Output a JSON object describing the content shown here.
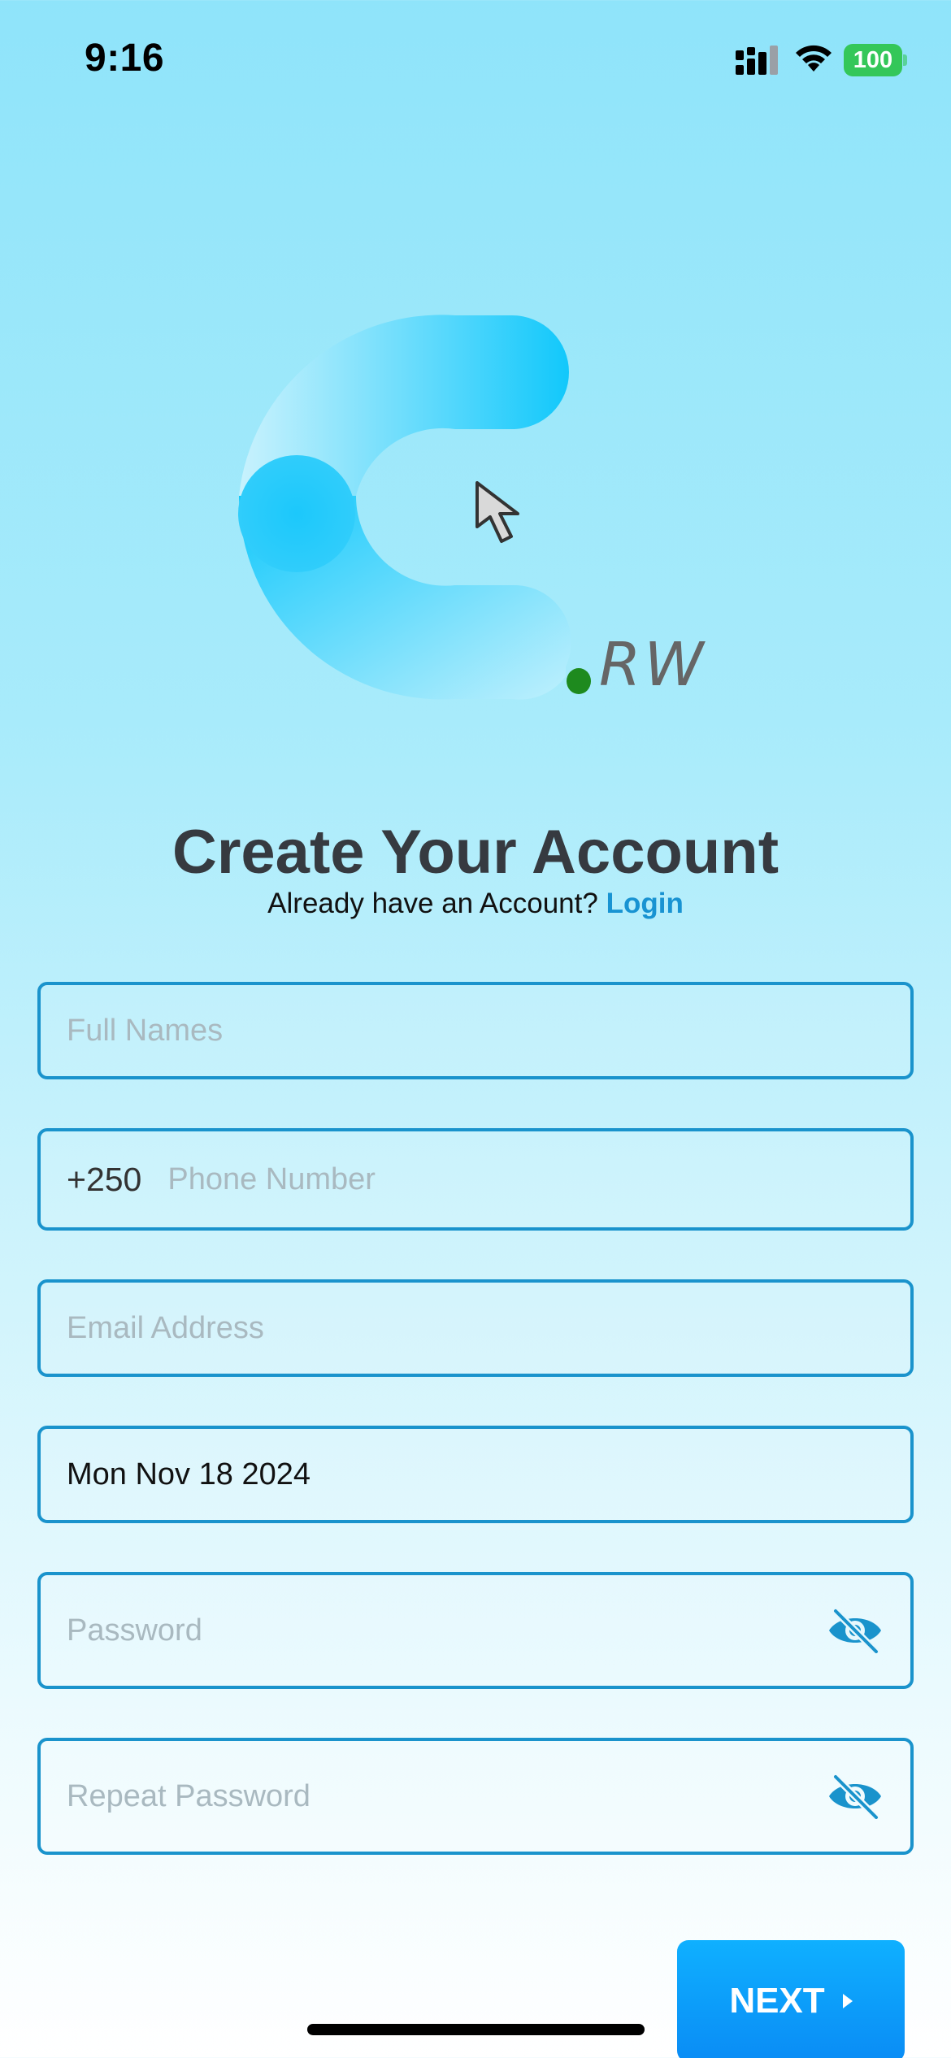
{
  "status_bar": {
    "time": "9:16",
    "battery": "100"
  },
  "logo": {
    "suffix": "RW",
    "icon": "c-logo-icon"
  },
  "header": {
    "title": "Create Your Account",
    "prompt": "Already have an Account?",
    "login_link": "Login"
  },
  "form": {
    "full_names": {
      "placeholder": "Full Names",
      "value": ""
    },
    "phone": {
      "prefix": "+250",
      "placeholder": "Phone Number",
      "value": ""
    },
    "email": {
      "placeholder": "Email Address",
      "value": ""
    },
    "date": {
      "value": "Mon Nov 18 2024"
    },
    "password": {
      "placeholder": "Password",
      "value": ""
    },
    "repeat_password": {
      "placeholder": "Repeat Password",
      "value": ""
    }
  },
  "actions": {
    "next_label": "NEXT"
  },
  "colors": {
    "accent": "#1893d2",
    "button": "#0a8cf5",
    "border": "#1a93cc"
  }
}
